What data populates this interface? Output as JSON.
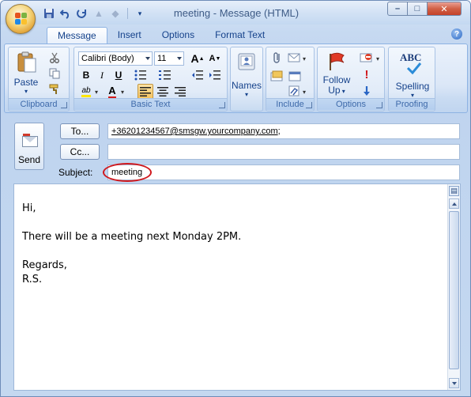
{
  "window": {
    "title": "meeting - Message (HTML)",
    "controls": {
      "minimize": "–",
      "maximize": "□",
      "close": "✕"
    }
  },
  "quick_access": {
    "save_icon": "save-icon",
    "undo_icon": "undo-icon",
    "redo_icon": "redo-icon",
    "up_icon": "up-arrow-icon",
    "down_icon": "down-arrow-icon",
    "customize_icon": "customize-qat-icon"
  },
  "tabs": [
    {
      "label": "Message",
      "active": true
    },
    {
      "label": "Insert",
      "active": false
    },
    {
      "label": "Options",
      "active": false
    },
    {
      "label": "Format Text",
      "active": false
    }
  ],
  "help": "?",
  "ribbon": {
    "clipboard": {
      "label": "Clipboard",
      "paste": "Paste",
      "cut_icon": "scissors-icon",
      "copy_icon": "copy-icon",
      "format_painter_icon": "format-painter-icon"
    },
    "basic_text": {
      "label": "Basic Text",
      "font": "Calibri (Body)",
      "size": "11",
      "grow": "A",
      "shrink": "A",
      "bold": "B",
      "italic": "I",
      "underline": "U",
      "highlight": "ab",
      "font_color": "A"
    },
    "names": {
      "label": "Names"
    },
    "include": {
      "label": "Include"
    },
    "options": {
      "label": "Options",
      "follow_up": "Follow",
      "follow_up_line2": "Up"
    },
    "proofing": {
      "label": "Proofing",
      "spelling": "Spelling",
      "abc": "ABC"
    }
  },
  "header": {
    "send": "Send",
    "to_button": "To...",
    "cc_button": "Cc...",
    "subject_label": "Subject:",
    "to_value": "+36201234567@smsgw.yourcompany.com",
    "to_suffix": ";",
    "cc_value": "",
    "subject_value": "meeting"
  },
  "body": {
    "lines": [
      "Hi,",
      "",
      "There will be a meeting next Monday 2PM.",
      "",
      "Regards,",
      "R.S."
    ]
  },
  "colors": {
    "highlight_oval": "#d0181d",
    "ribbon_text": "#15428b",
    "group_label": "#3e6aaa",
    "active_align": "#f6c25b"
  }
}
